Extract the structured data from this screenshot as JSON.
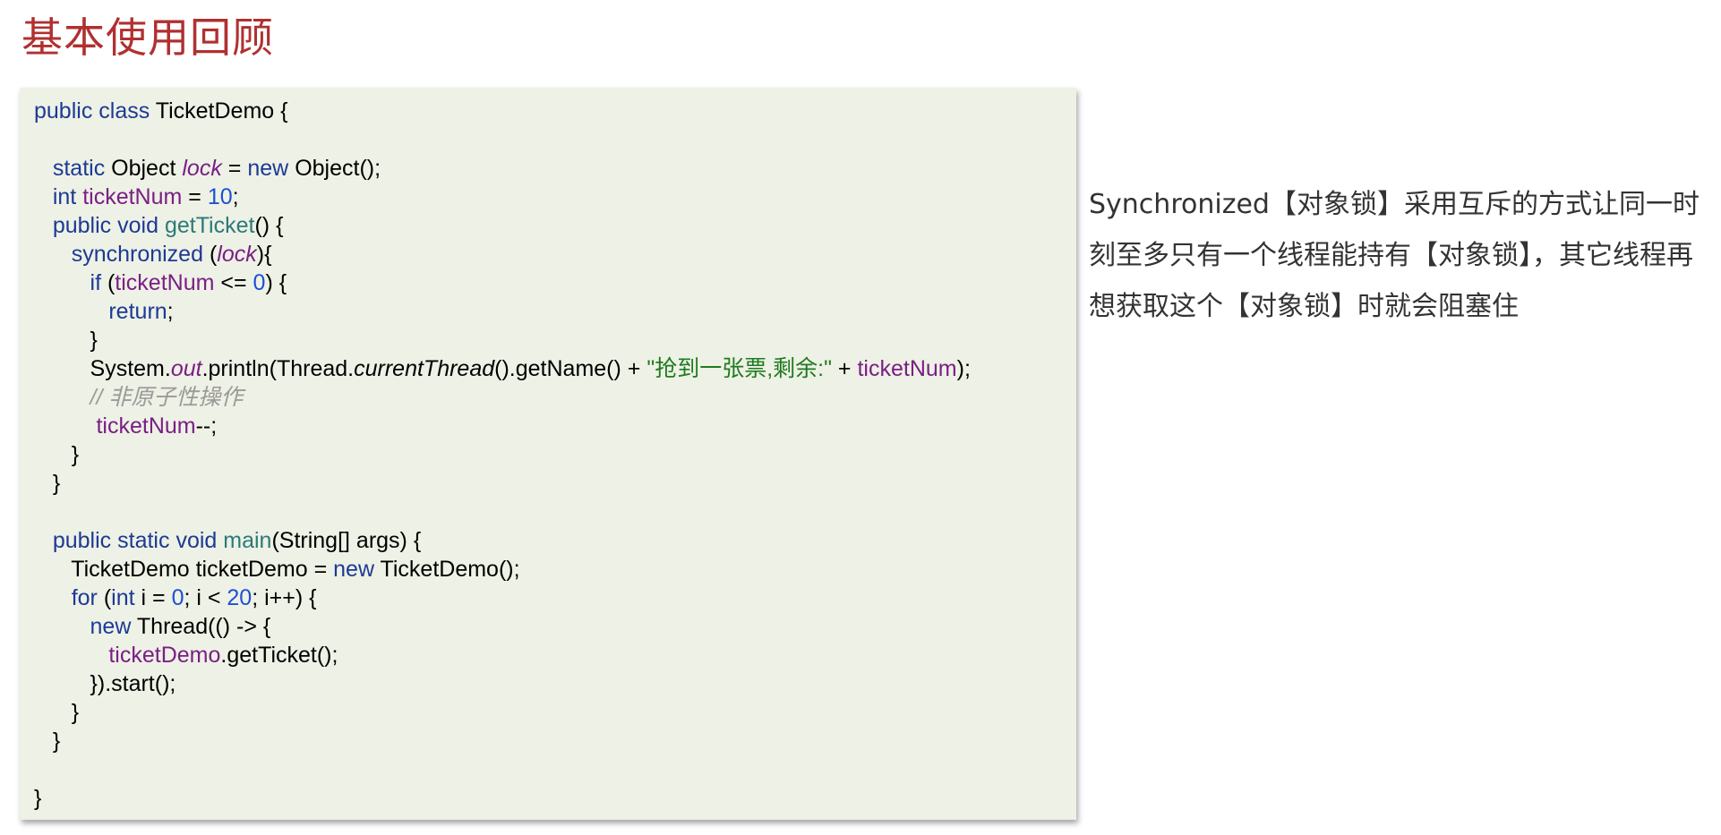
{
  "title": "基本使用回顾",
  "code": {
    "kw_public": "public",
    "kw_class": "class",
    "class_name": "TicketDemo",
    "brace_open": "{",
    "brace_close": "}",
    "kw_static": "static",
    "type_object": "Object",
    "field_lock": "lock",
    "equals": "=",
    "kw_new": "new",
    "object_ctor": "Object();",
    "kw_int": "int",
    "field_ticketnum": "ticketNum",
    "num_10": "10",
    "semicolon": ";",
    "kw_void": "void",
    "method_getticket": "getTicket",
    "parens_brace": "() {",
    "kw_synchronized": "synchronized",
    "paren_open": "(",
    "paren_brace_close": "){",
    "kw_if": "if",
    "le": "<=",
    "num_0": "0",
    "paren_close_brace": ") {",
    "kw_return": "return",
    "system": "System.",
    "out": "out",
    "println_thread": ".println(Thread.",
    "current_thread": "currentThread",
    "getname_plus": "().getName() + ",
    "string_literal": "\"抢到一张票,剩余:\"",
    "plus": " + ",
    "paren_semicolon": ");",
    "comment": "// 非原子性操作",
    "decrement": "--;",
    "method_main": "main",
    "main_params": "(String[] args) {",
    "ticketdemo_decl": "TicketDemo ticketDemo = ",
    "ticketdemo_ctor": "TicketDemo();",
    "kw_for": "for",
    "for_i": " i = ",
    "for_cond": "; i < ",
    "num_20": "20",
    "for_incr": "; i++) {",
    "thread_lambda": "Thread(() -> {",
    "ticketdemo_var": "ticketDemo",
    "getticket_call": ".getTicket();",
    "start_call": "}).start();"
  },
  "description": "Synchronized【对象锁】采用互斥的方式让同一时刻至多只有一个线程能持有【对象锁】，其它线程再想获取这个【对象锁】时就会阻塞住"
}
